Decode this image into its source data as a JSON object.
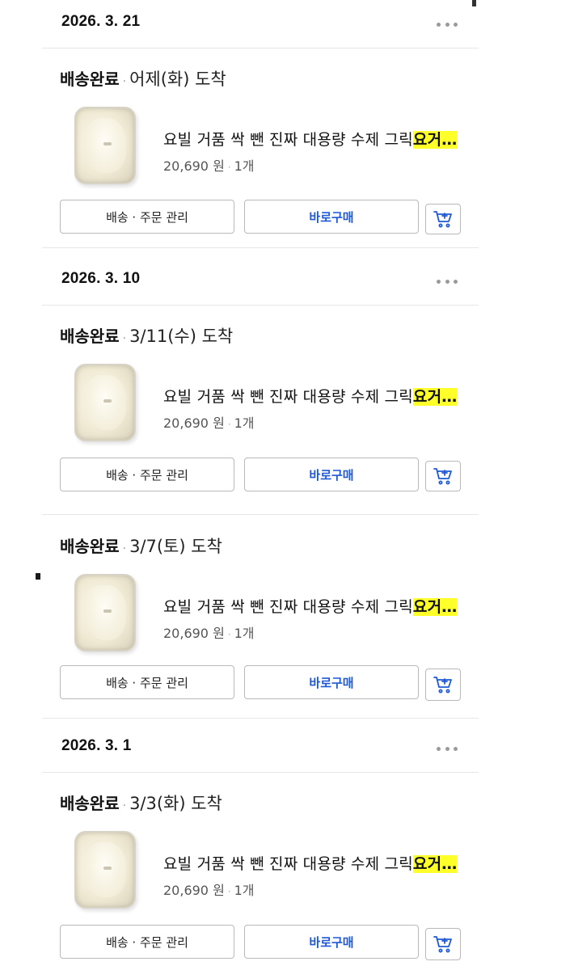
{
  "orders": [
    {
      "date": "2026. 3. 21",
      "status": "배송완료",
      "separator": "·",
      "arrival": "어제(화) 도착",
      "title_main": "요빌 거품 싹 뺀 진짜 대용량 수제 그릭",
      "title_highlight": "요거…",
      "price": "20,690 원",
      "qty_sep": "·",
      "qty": "1개",
      "manage_label": "배송 · 주문 관리",
      "buy_label": "바로구매"
    },
    {
      "date": "2026. 3. 10",
      "status": "배송완료",
      "separator": "·",
      "arrival": "3/11(수) 도착",
      "title_main": "요빌 거품 싹 뺀 진짜 대용량 수제 그릭",
      "title_highlight": "요거…",
      "price": "20,690 원",
      "qty_sep": "·",
      "qty": "1개",
      "manage_label": "배송 · 주문 관리",
      "buy_label": "바로구매"
    },
    {
      "date": "",
      "status": "배송완료",
      "separator": "·",
      "arrival": "3/7(토) 도착",
      "title_main": "요빌 거품 싹 뺀 진짜 대용량 수제 그릭",
      "title_highlight": "요거…",
      "price": "20,690 원",
      "qty_sep": "·",
      "qty": "1개",
      "manage_label": "배송 · 주문 관리",
      "buy_label": "바로구매"
    },
    {
      "date": "2026. 3. 1",
      "status": "배송완료",
      "separator": "·",
      "arrival": "3/3(화) 도착",
      "title_main": "요빌 거품 싹 뺀 진짜 대용량 수제 그릭",
      "title_highlight": "요거…",
      "price": "20,690 원",
      "qty_sep": "·",
      "qty": "1개",
      "manage_label": "배송 · 주문 관리",
      "buy_label": "바로구매"
    }
  ],
  "colors": {
    "highlight": "#ffff2a",
    "buy_text": "#1f59d6",
    "divider": "#e6e6e6"
  },
  "icons": {
    "more": "more-dots-icon",
    "cart": "add-to-cart-icon"
  }
}
